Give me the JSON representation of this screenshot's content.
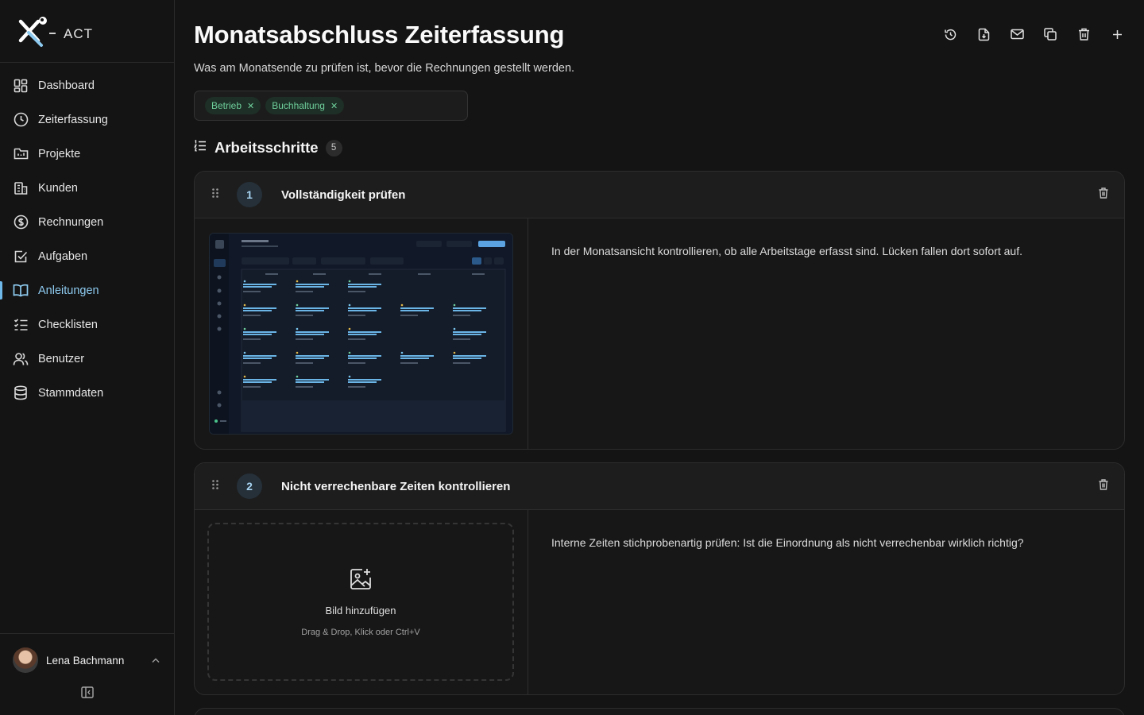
{
  "app": {
    "logo_text": "X-ACT"
  },
  "sidebar": {
    "items": [
      {
        "label": "Dashboard",
        "icon": "dashboard-icon"
      },
      {
        "label": "Zeiterfassung",
        "icon": "clock-icon"
      },
      {
        "label": "Projekte",
        "icon": "folder-icon"
      },
      {
        "label": "Kunden",
        "icon": "building-icon"
      },
      {
        "label": "Rechnungen",
        "icon": "dollar-icon"
      },
      {
        "label": "Aufgaben",
        "icon": "checkbox-icon"
      },
      {
        "label": "Anleitungen",
        "icon": "book-icon",
        "active": true
      },
      {
        "label": "Checklisten",
        "icon": "checklist-icon"
      },
      {
        "label": "Benutzer",
        "icon": "users-icon"
      },
      {
        "label": "Stammdaten",
        "icon": "database-icon"
      }
    ],
    "user": {
      "name": "Lena Bachmann"
    }
  },
  "page": {
    "title": "Monatsabschluss Zeiterfassung",
    "subtitle": "Was am Monatsende zu prüfen ist, bevor die Rechnungen gestellt werden.",
    "tags": [
      "Betrieb",
      "Buchhaltung"
    ],
    "toolbar": [
      "history-icon",
      "download-icon",
      "mail-icon",
      "duplicate-icon",
      "trash-icon",
      "plus-icon"
    ]
  },
  "steps_section": {
    "title": "Arbeitsschritte",
    "count": "5"
  },
  "steps": [
    {
      "number": "1",
      "title": "Vollständigkeit prüfen",
      "text": "In der Monatsansicht kontrollieren, ob alle Arbeitstage erfasst sind. Lücken fallen dort sofort auf.",
      "has_image": true
    },
    {
      "number": "2",
      "title": "Nicht verrechenbare Zeiten kontrollieren",
      "text": "Interne Zeiten stichprobenartig prüfen: Ist die Einordnung als nicht verrechenbar wirklich richtig?",
      "has_image": false,
      "dropzone": {
        "label": "Bild hinzufügen",
        "hint": "Drag & Drop, Klick oder Ctrl+V"
      }
    }
  ],
  "colors": {
    "accent": "#6fb8ea",
    "tag_bg": "#1d2f26",
    "tag_text": "#6fcf9c"
  }
}
